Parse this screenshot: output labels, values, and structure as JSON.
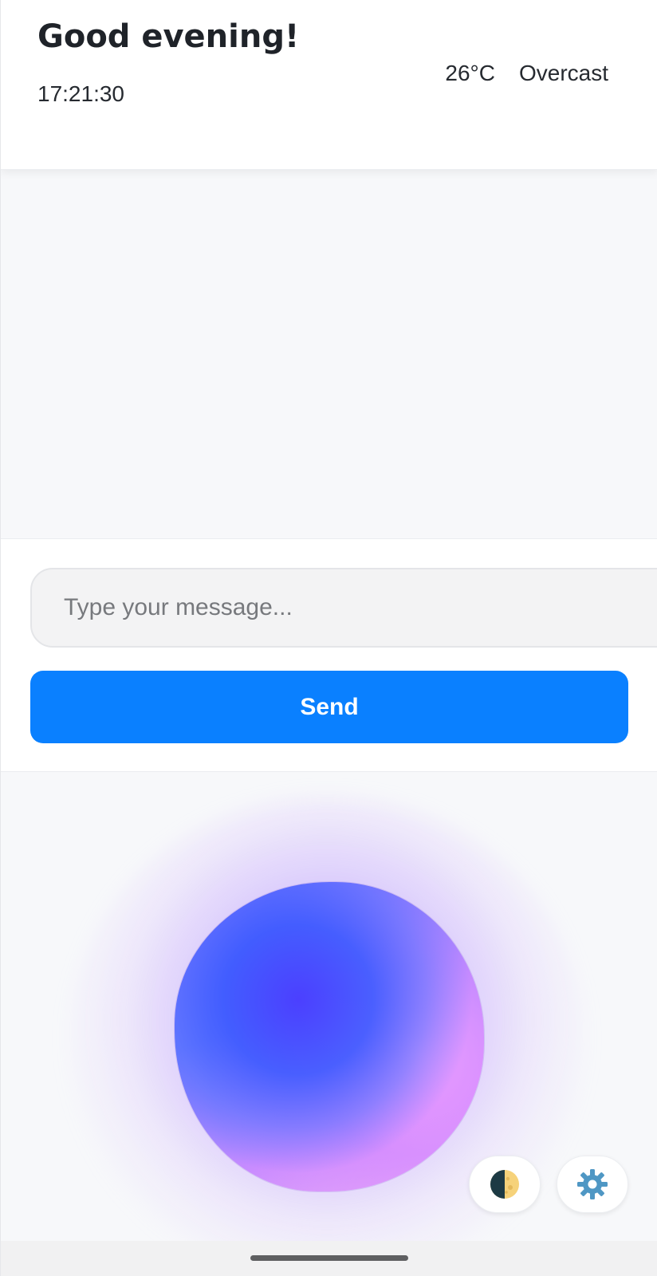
{
  "header": {
    "greeting": "Good evening!",
    "time": "17:21:30",
    "weather": {
      "temperature": "26°C",
      "condition": "Overcast"
    }
  },
  "composer": {
    "input_value": "",
    "input_placeholder": "Type your message...",
    "send_label": "Send"
  },
  "floating_buttons": {
    "theme_icon": "half-moon-icon",
    "settings_icon": "gear-icon"
  },
  "colors": {
    "accent": "#0a80ff",
    "background": "#f7f8fa"
  }
}
